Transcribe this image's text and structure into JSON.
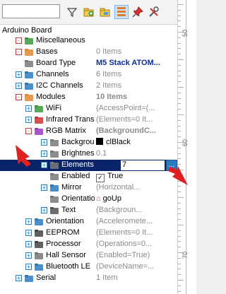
{
  "toolbar": {
    "search_placeholder": "",
    "icons": [
      "filter-icon",
      "add-folder-icon",
      "folder-icon",
      "view-icon",
      "pin-icon",
      "settings-icon"
    ]
  },
  "tree": {
    "root_label": "Arduino Board",
    "rows": [
      {
        "name": "Miscellaneous",
        "value": "",
        "indent": 0,
        "exp": "-",
        "expStyle": "red",
        "icon": "folder-green"
      },
      {
        "name": "Bases",
        "value": "0 Items",
        "indent": 1,
        "exp": "-",
        "expStyle": "red",
        "icon": "folder-orange"
      },
      {
        "name": "Board Type",
        "value": "M5 Stack ATOM...",
        "indent": 1,
        "exp": "",
        "icon": "gear",
        "valStyle": "bold"
      },
      {
        "name": "Channels",
        "value": "6 Items",
        "indent": 1,
        "exp": "+",
        "expStyle": "blue",
        "icon": "channels"
      },
      {
        "name": "I2C Channels",
        "value": "2 Items",
        "indent": 1,
        "exp": "+",
        "expStyle": "blue",
        "icon": "i2c"
      },
      {
        "name": "Modules",
        "value": "10 Items",
        "indent": 1,
        "exp": "-",
        "expStyle": "red",
        "icon": "folder-orange",
        "valStyle": "boldgray"
      },
      {
        "name": "WiFi",
        "value": "(AccessPoint=(...",
        "indent": 2,
        "exp": "+",
        "expStyle": "blue",
        "icon": "wifi"
      },
      {
        "name": "Infrared Trans...",
        "value": "(Elements=0 It...",
        "indent": 2,
        "exp": "+",
        "expStyle": "blue",
        "icon": "ir"
      },
      {
        "name": "RGB Matrix",
        "value": "(BackgroundC...",
        "indent": 2,
        "exp": "-",
        "expStyle": "red",
        "icon": "rgb",
        "valStyle": "boldgray"
      },
      {
        "name": "Backgroun...",
        "value": "clBlack",
        "indent": 3,
        "exp": "+",
        "expStyle": "blue",
        "icon": "gear",
        "valPrefix": "square"
      },
      {
        "name": "Brightness",
        "value": "0.1",
        "indent": 3,
        "exp": "+",
        "expStyle": "blue",
        "icon": "gear"
      },
      {
        "name": "Elements",
        "value": "7",
        "indent": 3,
        "exp": "+",
        "expStyle": "blue",
        "icon": "gear",
        "selected": true,
        "ellipsis": "..."
      },
      {
        "name": "Enabled",
        "value": "True",
        "indent": 3,
        "exp": "",
        "icon": "gear",
        "valPrefix": "check"
      },
      {
        "name": "Mirror",
        "value": "(Horizontal...",
        "indent": 3,
        "exp": "+",
        "expStyle": "blue",
        "icon": "mirror"
      },
      {
        "name": "Orientation",
        "value": "goUp",
        "indent": 3,
        "exp": "",
        "icon": "gear",
        "valPrefix": "home"
      },
      {
        "name": "Text",
        "value": "(Backgroun...",
        "indent": 3,
        "exp": "+",
        "expStyle": "blue",
        "icon": "text"
      },
      {
        "name": "Orientation",
        "value": "(Acceleromete...",
        "indent": 2,
        "exp": "+",
        "expStyle": "blue",
        "icon": "orientation"
      },
      {
        "name": "EEPROM",
        "value": "(Elements=0 It...",
        "indent": 2,
        "exp": "+",
        "expStyle": "blue",
        "icon": "eeprom"
      },
      {
        "name": "Processor",
        "value": "(Operations=0...",
        "indent": 2,
        "exp": "+",
        "expStyle": "blue",
        "icon": "chip"
      },
      {
        "name": "Hall Sensor",
        "value": "(Enabled=True)",
        "indent": 2,
        "exp": "+",
        "expStyle": "blue",
        "icon": "hall"
      },
      {
        "name": "Bluetooth LE",
        "value": "(DeviceName=...",
        "indent": 2,
        "exp": "+",
        "expStyle": "blue",
        "icon": "bluetooth"
      },
      {
        "name": "Serial",
        "value": "1 Item",
        "indent": 0,
        "exp": "+",
        "expStyle": "blue",
        "icon": "serial"
      }
    ],
    "prefix_check_mark": "✓",
    "prefix_home_glyph": "⌂"
  },
  "ruler": {
    "labels": [
      "50",
      "60",
      "70"
    ]
  },
  "colors": {
    "selection": "#0a246a",
    "value_bold": "#0c2fa0",
    "annotation_arrow": "#e02020"
  }
}
